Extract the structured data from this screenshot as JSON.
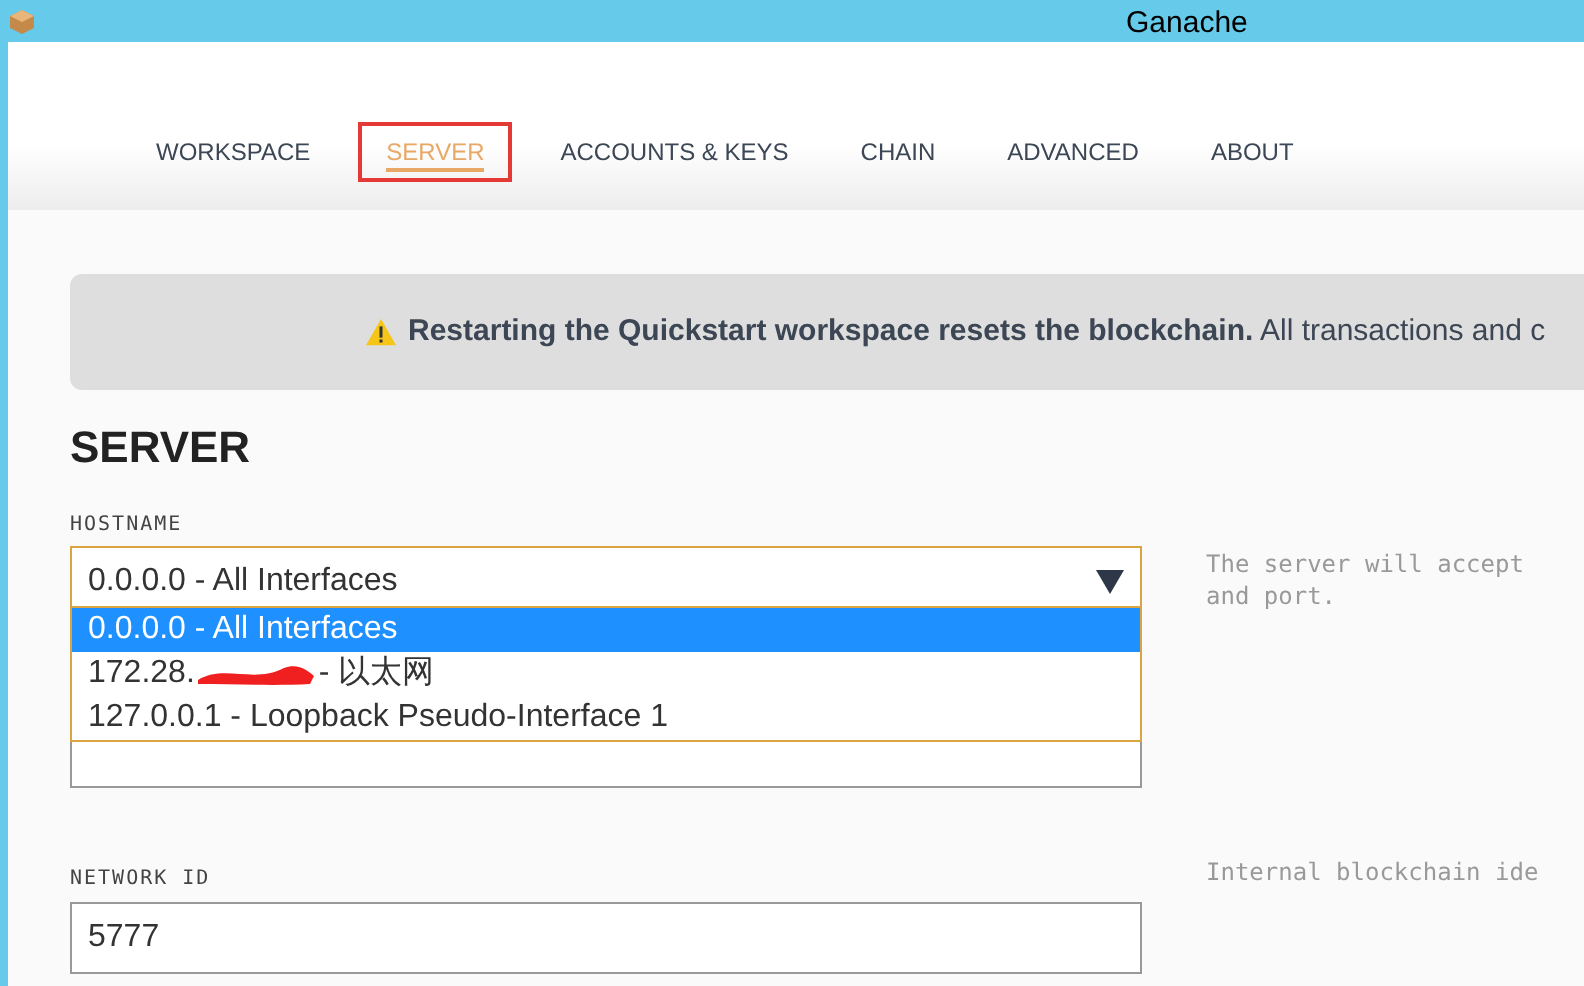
{
  "window": {
    "title": "Ganache"
  },
  "tabs": [
    {
      "label": "WORKSPACE",
      "selected": false
    },
    {
      "label": "SERVER",
      "selected": true
    },
    {
      "label": "ACCOUNTS & KEYS",
      "selected": false
    },
    {
      "label": "CHAIN",
      "selected": false
    },
    {
      "label": "ADVANCED",
      "selected": false
    },
    {
      "label": "ABOUT",
      "selected": false
    }
  ],
  "banner": {
    "bold": "Restarting the Quickstart workspace resets the blockchain.",
    "text": "All transactions and c"
  },
  "section_title": "SERVER",
  "hostname": {
    "label": "HOSTNAME",
    "value": "0.0.0.0 - All Interfaces",
    "help": [
      "The server will accept",
      "and port."
    ],
    "options": [
      {
        "label": "0.0.0.0 - All Interfaces",
        "selected": true
      },
      {
        "label": "172.28.",
        "suffix": "- 以太网",
        "redacted": true,
        "selected": false
      },
      {
        "label": "127.0.0.1 - Loopback Pseudo-Interface 1",
        "selected": false
      }
    ]
  },
  "network_id": {
    "label": "NETWORK ID",
    "value": "5777",
    "help": "Internal blockchain ide"
  }
}
